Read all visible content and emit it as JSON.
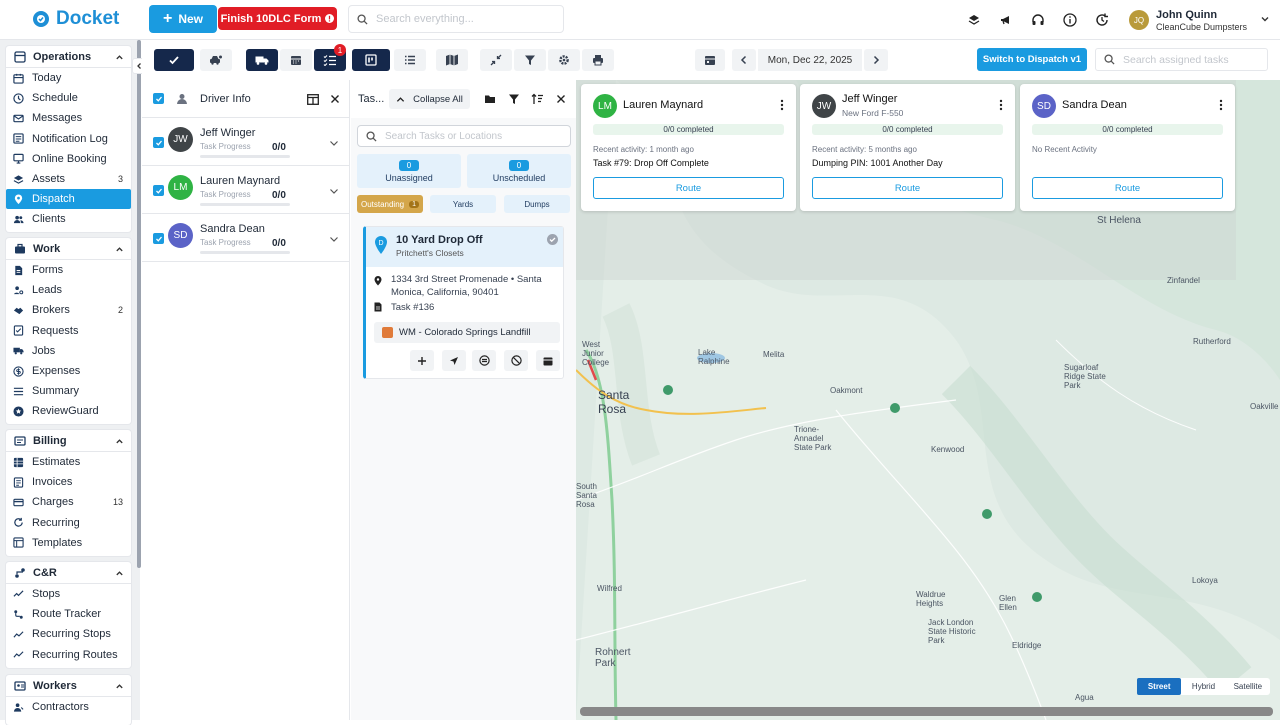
{
  "app": {
    "name": "Docket"
  },
  "top": {
    "new_label": "New",
    "finish_label": "Finish 10DLC Form",
    "search_placeholder": "Search everything...",
    "user_initials": "JQ",
    "user_name": "John Quinn",
    "user_company": "CleanCube Dumpsters"
  },
  "sidebar": {
    "operations": {
      "title": "Operations",
      "items": [
        {
          "label": "Today"
        },
        {
          "label": "Schedule"
        },
        {
          "label": "Messages"
        },
        {
          "label": "Notification Log"
        },
        {
          "label": "Online Booking"
        },
        {
          "label": "Assets",
          "count": "3"
        },
        {
          "label": "Dispatch"
        },
        {
          "label": "Clients"
        }
      ]
    },
    "work": {
      "title": "Work",
      "items": [
        {
          "label": "Forms"
        },
        {
          "label": "Leads"
        },
        {
          "label": "Brokers",
          "count": "2"
        },
        {
          "label": "Requests"
        },
        {
          "label": "Jobs"
        },
        {
          "label": "Expenses"
        },
        {
          "label": "Summary"
        },
        {
          "label": "ReviewGuard"
        }
      ]
    },
    "billing": {
      "title": "Billing",
      "items": [
        {
          "label": "Estimates"
        },
        {
          "label": "Invoices"
        },
        {
          "label": "Charges",
          "count": "13"
        },
        {
          "label": "Recurring"
        },
        {
          "label": "Templates"
        }
      ]
    },
    "cr": {
      "title": "C&R",
      "items": [
        {
          "label": "Stops"
        },
        {
          "label": "Route Tracker"
        },
        {
          "label": "Recurring Stops"
        },
        {
          "label": "Recurring Routes"
        }
      ]
    },
    "workers": {
      "title": "Workers",
      "items": [
        {
          "label": "Contractors"
        }
      ]
    }
  },
  "toolbar": {
    "badge": "1",
    "date": "Mon, Dec 22, 2025",
    "switch_label": "Switch to Dispatch v1",
    "search_placeholder": "Search assigned tasks"
  },
  "drivers": {
    "title": "Driver Info",
    "rows": [
      {
        "initials": "JW",
        "name": "Jeff Winger",
        "sub": "Task Progress",
        "count": "0/0",
        "color": "#3f4447"
      },
      {
        "initials": "LM",
        "name": "Lauren Maynard",
        "sub": "Task Progress",
        "count": "0/0",
        "color": "#2fb344"
      },
      {
        "initials": "SD",
        "name": "Sandra Dean",
        "sub": "Task Progress",
        "count": "0/0",
        "color": "#5b63c7"
      }
    ]
  },
  "tasks": {
    "title": "Tas...",
    "collapse_label": "Collapse All",
    "search_placeholder": "Search Tasks or Locations",
    "unassigned": {
      "count": "0",
      "label": "Unassigned"
    },
    "unscheduled": {
      "count": "0",
      "label": "Unscheduled"
    },
    "tabs": [
      {
        "label": "Outstanding",
        "count": "1"
      },
      {
        "label": "Yards"
      },
      {
        "label": "Dumps"
      }
    ],
    "card": {
      "pin": "D",
      "title": "10 Yard Drop Off",
      "subtitle": "Pritchett's Closets",
      "address": "1334 3rd Street Promenade • Santa Monica, California, 90401",
      "task": "Task #136",
      "yard": "WM - Colorado Springs Landfill"
    }
  },
  "driver_cards": [
    {
      "initials": "LM",
      "name": "Lauren Maynard",
      "vehicle": "",
      "completed": "0/0 completed",
      "recent": "Recent activity: 1 month ago",
      "detail": "Task #79: Drop Off Complete",
      "route": "Route",
      "color": "#2fb344"
    },
    {
      "initials": "JW",
      "name": "Jeff Winger",
      "vehicle": "New Ford F-550",
      "completed": "0/0 completed",
      "recent": "Recent activity: 5 months ago",
      "detail": "Dumping PIN: 1001 Another Day",
      "route": "Route",
      "color": "#3f4447"
    },
    {
      "initials": "SD",
      "name": "Sandra Dean",
      "vehicle": "",
      "completed": "0/0 completed",
      "recent": "No Recent Activity",
      "detail": "",
      "route": "Route",
      "color": "#5b63c7"
    }
  ],
  "map": {
    "labels": [
      "St Helena",
      "Zinfandel",
      "West Junior College",
      "Lake Ralphine",
      "Melita",
      "Rutherford",
      "Santa Rosa",
      "Oakmont",
      "Sugarloaf Ridge State Park",
      "Oakville",
      "Trione-Annadel State Park",
      "Kenwood",
      "South Santa Rosa",
      "Wilfred",
      "Waldrue Heights",
      "Glen Ellen",
      "Jack London State Historic Park",
      "Lokoya",
      "Rohnert Park",
      "Eldridge",
      "Agua"
    ],
    "types": [
      "Street",
      "Hybrid",
      "Satellite"
    ]
  }
}
